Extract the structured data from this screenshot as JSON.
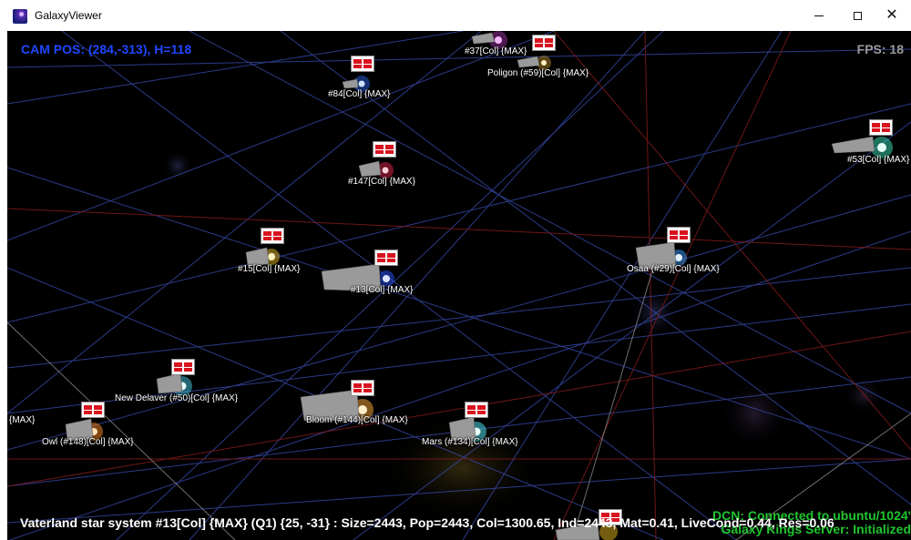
{
  "window": {
    "title": "GalaxyViewer",
    "controls": {
      "minimize": "minimize",
      "maximize": "maximize",
      "close": "close"
    }
  },
  "hud": {
    "cam_pos": "CAM POS: (284,-313), H=118",
    "fps": "FPS: 18"
  },
  "status": {
    "line": "Vaterland star system #13[Col] {MAX} (Q1)  {25, -31} :  Size=2443, Pop=2443, Col=1300.65, Ind=2443, Mat=0.41, LiveCond=0.44, Res=0.06",
    "dcn": "DCN: Connected to ubuntu/1024'",
    "server": "Galaxy Kings Server: Initialized"
  },
  "colors": {
    "cam_pos": "#1f47ff",
    "fps": "#9a9a9a",
    "server_status": "#1fc62e",
    "grid_blue": "#3b4fb5",
    "grid_red": "#7a1a1a",
    "flag_red": "#d8141f"
  },
  "stars": [
    {
      "label": "#37[Col] {MAX}",
      "color": "#e04be8",
      "flag": true
    },
    {
      "label": "Poligon (#59)[Col] {MAX}",
      "color": "#ffc23a",
      "flag": true
    },
    {
      "label": "#84[Col] {MAX}",
      "color": "#2f6dff",
      "flag": true
    },
    {
      "label": "#147[Col] {MAX}",
      "color": "#ff2a55",
      "flag": true
    },
    {
      "label": "#53[Col] {MAX}",
      "color": "#43ffcf",
      "flag": true
    },
    {
      "label": "#15[Col] {MAX}",
      "color": "#ffcc22",
      "flag": true
    },
    {
      "label": "#13[Col] {MAX}",
      "color": "#2a55ff",
      "flag": true
    },
    {
      "label": "Osaa (#29)[Col] {MAX}",
      "color": "#3aa0ff",
      "flag": true
    },
    {
      "label": "New Delaver (#50)[Col] {MAX}",
      "color": "#4fe3ff",
      "flag": true
    },
    {
      "label": "Bloom (#144)[Col] {MAX}",
      "color": "#ffb03a",
      "flag": true
    },
    {
      "label": "Mars (#134)[Col] {MAX}",
      "color": "#53f0ff",
      "flag": true
    },
    {
      "label": "Owl (#148)[Col] {MAX}",
      "color": "#ff8a22",
      "flag": true
    },
    {
      "label": "{MAX}",
      "color": "#ffffff",
      "flag": false
    }
  ]
}
